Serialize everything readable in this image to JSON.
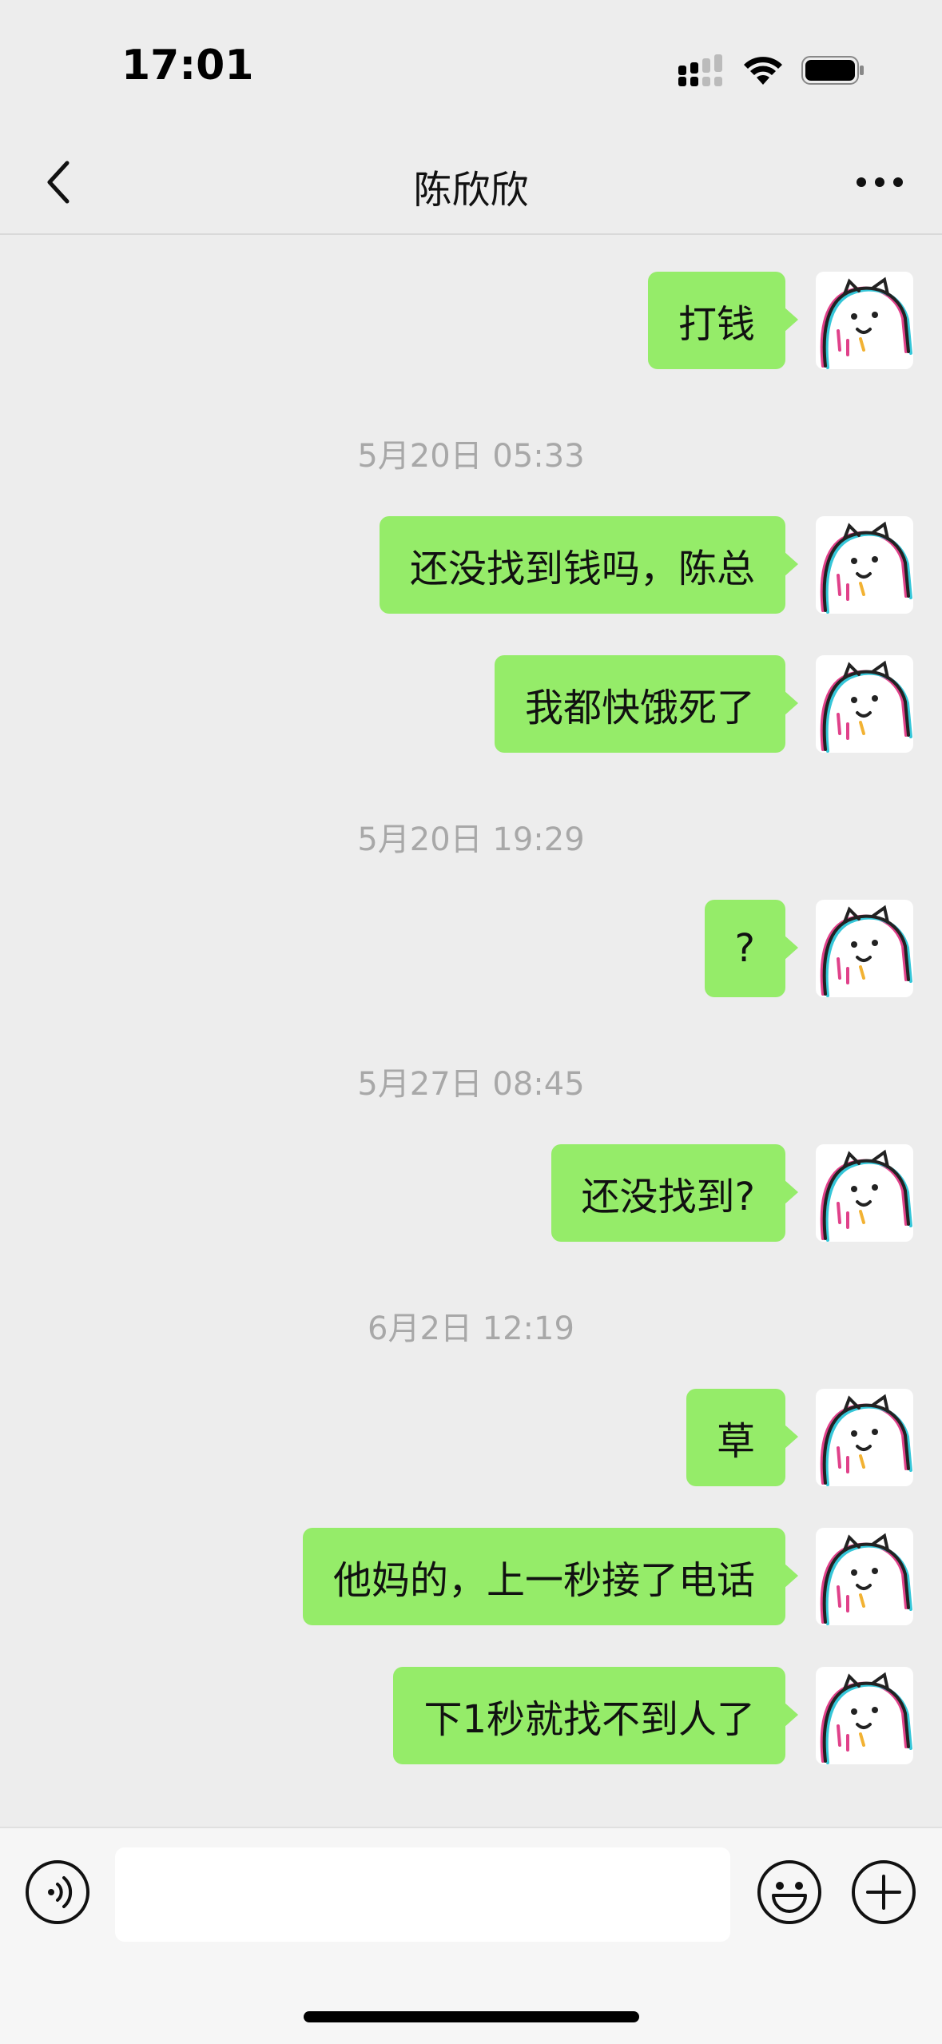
{
  "status_bar": {
    "time": "17:01",
    "icons": [
      "cellular-signal-icon",
      "wifi-icon",
      "battery-icon"
    ]
  },
  "nav": {
    "back_icon": "chevron-left-icon",
    "title": "陈欣欣",
    "more_icon": "ellipsis-icon"
  },
  "messages": [
    {
      "type": "sent",
      "text": "打钱"
    },
    {
      "type": "time",
      "text": "5月20日 05:33"
    },
    {
      "type": "sent",
      "text": "还没找到钱吗，陈总"
    },
    {
      "type": "sent",
      "text": "我都快饿死了"
    },
    {
      "type": "time",
      "text": "5月20日 19:29"
    },
    {
      "type": "sent",
      "text": "?"
    },
    {
      "type": "time",
      "text": "5月27日 08:45"
    },
    {
      "type": "sent",
      "text": "还没找到?"
    },
    {
      "type": "time",
      "text": "6月2日 12:19"
    },
    {
      "type": "sent",
      "text": "草"
    },
    {
      "type": "sent",
      "text": "他妈的，上一秒接了电话"
    },
    {
      "type": "sent",
      "text": "下1秒就找不到人了"
    }
  ],
  "input_bar": {
    "voice_icon": "voice-icon",
    "input_value": "",
    "emoji_icon": "emoji-icon",
    "plus_icon": "plus-icon"
  },
  "colors": {
    "background": "#EDEDED",
    "bubble": "#95EC69",
    "timestamp": "#A8A8A8"
  }
}
